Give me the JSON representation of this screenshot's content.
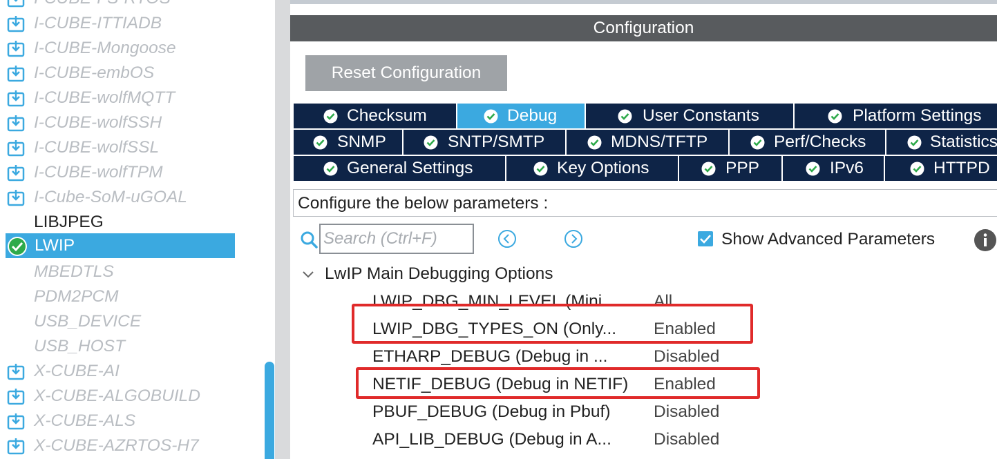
{
  "tree": {
    "items": [
      {
        "label": "I-CUBE-FS-RTOS",
        "kind": "pack"
      },
      {
        "label": "I-CUBE-ITTIADB",
        "kind": "pack"
      },
      {
        "label": "I-CUBE-Mongoose",
        "kind": "pack"
      },
      {
        "label": "I-CUBE-embOS",
        "kind": "pack"
      },
      {
        "label": "I-CUBE-wolfMQTT",
        "kind": "pack"
      },
      {
        "label": "I-CUBE-wolfSSH",
        "kind": "pack"
      },
      {
        "label": "I-CUBE-wolfSSL",
        "kind": "pack"
      },
      {
        "label": "I-CUBE-wolfTPM",
        "kind": "pack"
      },
      {
        "label": "I-Cube-SoM-uGOAL",
        "kind": "pack"
      },
      {
        "label": "LIBJPEG",
        "kind": "plain"
      },
      {
        "label": "LWIP",
        "kind": "selected"
      },
      {
        "label": "MBEDTLS",
        "kind": "off"
      },
      {
        "label": "PDM2PCM",
        "kind": "off"
      },
      {
        "label": "USB_DEVICE",
        "kind": "off"
      },
      {
        "label": "USB_HOST",
        "kind": "off"
      },
      {
        "label": "X-CUBE-AI",
        "kind": "pack"
      },
      {
        "label": "X-CUBE-ALGOBUILD",
        "kind": "pack"
      },
      {
        "label": "X-CUBE-ALS",
        "kind": "pack"
      },
      {
        "label": "X-CUBE-AZRTOS-H7",
        "kind": "pack"
      }
    ]
  },
  "config": {
    "header": "Configuration",
    "reset_label": "Reset Configuration",
    "tab_rows": [
      [
        {
          "label": "Checksum",
          "active": false
        },
        {
          "label": "Debug",
          "active": true
        },
        {
          "label": "User Constants",
          "active": false
        },
        {
          "label": "Platform Settings",
          "active": false
        }
      ],
      [
        {
          "label": "SNMP",
          "active": false
        },
        {
          "label": "SNTP/SMTP",
          "active": false
        },
        {
          "label": "MDNS/TFTP",
          "active": false
        },
        {
          "label": "Perf/Checks",
          "active": false
        },
        {
          "label": "Statistics",
          "active": false
        }
      ],
      [
        {
          "label": "General Settings",
          "active": false
        },
        {
          "label": "Key Options",
          "active": false
        },
        {
          "label": "PPP",
          "active": false
        },
        {
          "label": "IPv6",
          "active": false
        },
        {
          "label": "HTTPD",
          "active": false
        }
      ]
    ],
    "params_label": "Configure the below parameters :",
    "search_placeholder": "Search (Ctrl+F)",
    "show_advanced_label": "Show Advanced Parameters",
    "show_advanced_checked": true,
    "group_title": "LwIP Main Debugging Options",
    "params": [
      {
        "name": "LWIP_DBG_MIN_LEVEL (Mini...",
        "value": "All",
        "highlighted": false
      },
      {
        "name": "LWIP_DBG_TYPES_ON (Only...",
        "value": "Enabled",
        "highlighted": true
      },
      {
        "name": "ETHARP_DEBUG (Debug in ...",
        "value": "Disabled",
        "highlighted": false
      },
      {
        "name": "NETIF_DEBUG (Debug in NETIF)",
        "value": "Enabled",
        "highlighted": true
      },
      {
        "name": "PBUF_DEBUG (Debug in Pbuf)",
        "value": "Disabled",
        "highlighted": false
      },
      {
        "name": "API_LIB_DEBUG (Debug in A...",
        "value": "Disabled",
        "highlighted": false
      }
    ]
  },
  "colors": {
    "accent": "#3ba9e0",
    "tab_bg": "#0e2447",
    "header_bg": "#585b5e",
    "highlight_box": "#e02a2a"
  }
}
